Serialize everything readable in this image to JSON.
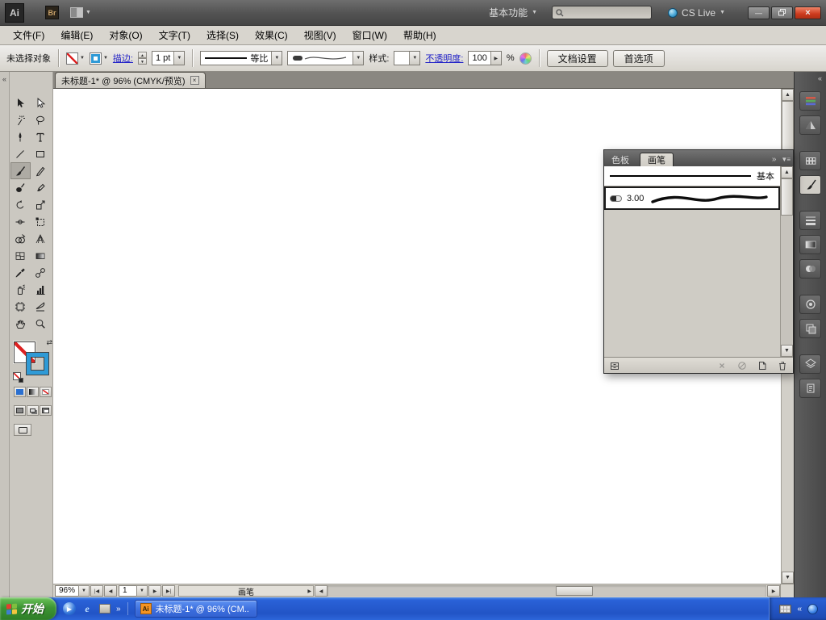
{
  "titlebar": {
    "app_badge": "Ai",
    "bridge_badge": "Br",
    "workspace_label": "基本功能",
    "cs_live_label": "CS Live",
    "search_value": ""
  },
  "menubar": {
    "items": [
      "文件(F)",
      "编辑(E)",
      "对象(O)",
      "文字(T)",
      "选择(S)",
      "效果(C)",
      "视图(V)",
      "窗口(W)",
      "帮助(H)"
    ]
  },
  "controlbar": {
    "selection_status": "未选择对象",
    "stroke_link": "描边:",
    "stroke_width_value": "1 pt",
    "profile_value": "等比",
    "style_label": "样式:",
    "opacity_link": "不透明度:",
    "opacity_value": "100",
    "opacity_unit": "%",
    "document_setup_button": "文档设置",
    "preferences_button": "首选项"
  },
  "document": {
    "tab_title": "未标题-1* @ 96% (CMYK/预览)"
  },
  "panel": {
    "tab_swatches": "色板",
    "tab_brushes": "画笔",
    "brush_basic_label": "基本",
    "brush_size_label": "3.00"
  },
  "statusbar": {
    "zoom_value": "96%",
    "artboard_number": "1",
    "status_text": "画笔"
  },
  "taskbar": {
    "start_label": "开始",
    "task_label": "未标题-1* @ 96% (CM..",
    "ie_letter": "e"
  },
  "icons": {
    "dropdown": "▼",
    "up": "▲",
    "down": "▼",
    "left": "◀",
    "right": "▶",
    "first": "|◀",
    "last": "▶|",
    "collapse": "«",
    "expand": "»",
    "close": "×",
    "minimize": "—",
    "swap": "⇄",
    "panel_menu": "▼≡"
  },
  "colors": {
    "stroke_swatch_blue": "#2f9ad6",
    "link_blue": "#2323c8",
    "close_button_red": "#cc3a1d",
    "taskbar_blue": "#2254c6",
    "start_button_green": "#3d9434"
  }
}
